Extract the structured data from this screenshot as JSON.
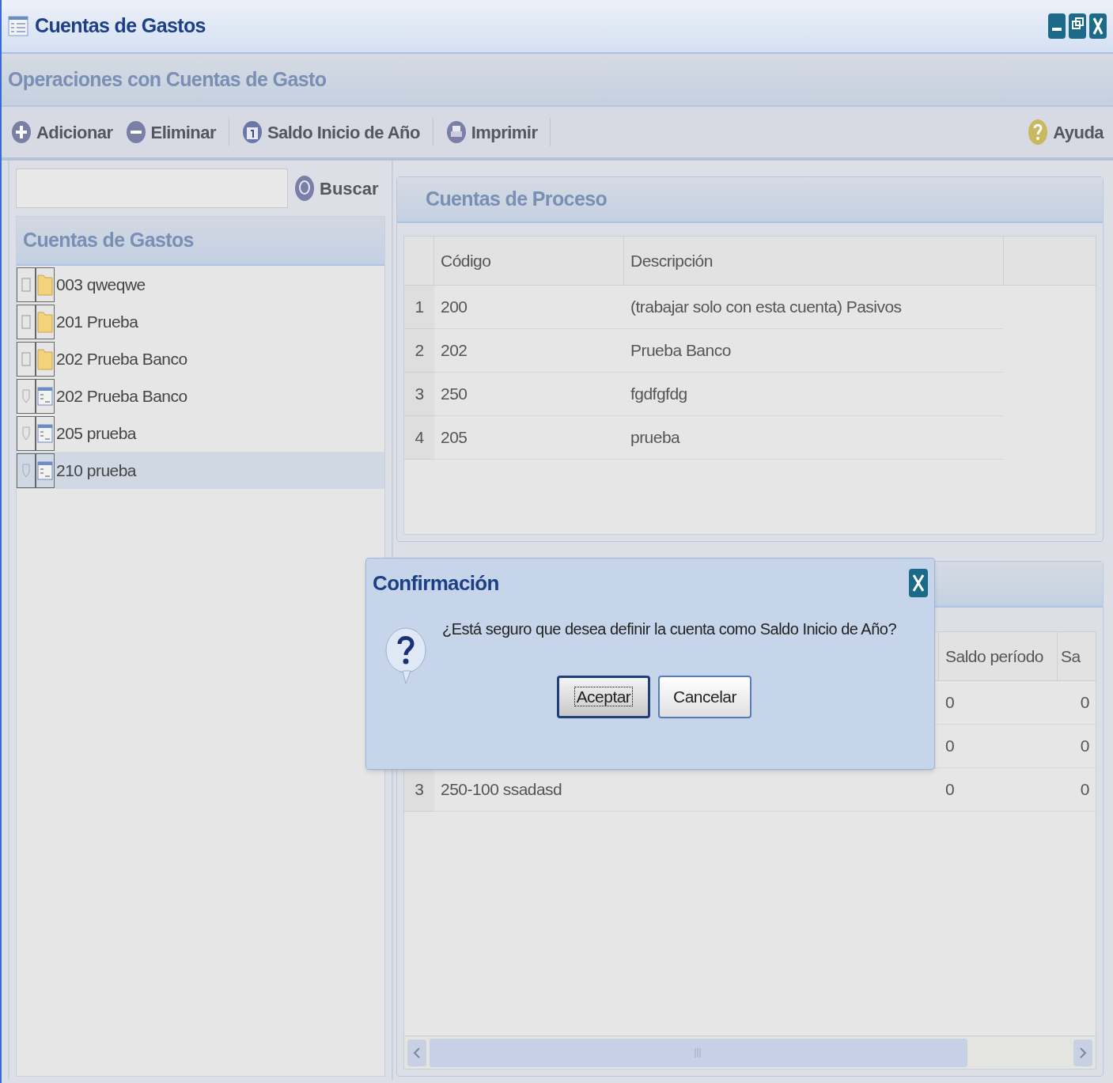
{
  "window": {
    "title": "Cuentas de Gastos"
  },
  "section_title": "Operaciones con Cuentas de Gasto",
  "toolbar": {
    "left": [
      {
        "label": "Adicionar",
        "kind": "add"
      },
      {
        "label": "Eliminar",
        "kind": "remove"
      },
      {
        "label": "Saldo Inicio de Año",
        "kind": "calendar"
      },
      {
        "label": "Imprimir",
        "kind": "print"
      }
    ],
    "right": [
      {
        "label": "Ayuda",
        "kind": "help"
      }
    ]
  },
  "search": {
    "button": "Buscar"
  },
  "tree": {
    "title": "Cuentas de Gastos",
    "items": [
      {
        "label": "003 qweqwe",
        "kind": "folder",
        "selected": false
      },
      {
        "label": "201 Prueba",
        "kind": "folder",
        "selected": false
      },
      {
        "label": "202 Prueba Banco",
        "kind": "folder",
        "selected": false
      },
      {
        "label": "202 Prueba Banco",
        "kind": "leaf",
        "selected": false
      },
      {
        "label": "205 prueba",
        "kind": "leaf",
        "selected": false
      },
      {
        "label": "210 prueba",
        "kind": "leaf",
        "selected": true
      }
    ]
  },
  "process_accounts": {
    "title": "Cuentas de Proceso",
    "columns": [
      "Código",
      "Descripción"
    ],
    "rows": [
      {
        "number": "1",
        "code": "200",
        "description": "(trabajar solo con esta cuenta) Pasivos"
      },
      {
        "number": "2",
        "code": "202",
        "description": "Prueba Banco"
      },
      {
        "number": "3",
        "code": "250",
        "description": "fgdfgfdg"
      },
      {
        "number": "4",
        "code": "205",
        "description": "prueba"
      }
    ]
  },
  "ledger": {
    "columns": [
      "Saldo período",
      "Sa"
    ],
    "rows": [
      {
        "column_2": "0",
        "column_3": "0"
      },
      {
        "column_2": "0",
        "column_3": "0"
      },
      {
        "number": "3",
        "account": "250-100 ssadasd",
        "column_2": "0",
        "column_3": "0"
      }
    ]
  },
  "dialog": {
    "title": "Confirmación",
    "message": "¿Está seguro que desea definir la cuenta como Saldo Inicio de Año?",
    "buttons": [
      {
        "label": "Aceptar",
        "focused": true
      },
      {
        "label": "Cancelar",
        "focused": false
      }
    ]
  }
}
